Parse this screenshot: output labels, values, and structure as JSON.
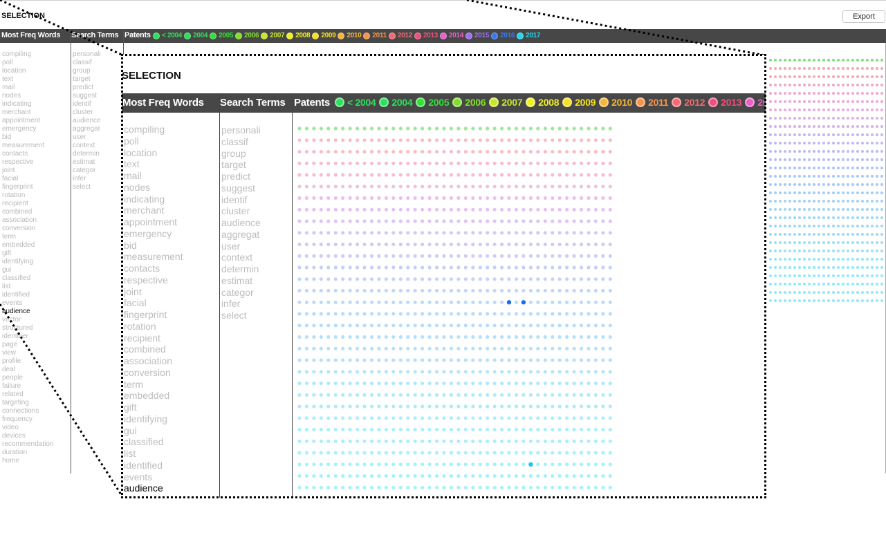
{
  "app": {
    "title": "SELECTION",
    "export_label": "Export"
  },
  "headers": {
    "most_freq_words": "Most Freq Words",
    "search_terms": "Search Terms",
    "patents": "Patents"
  },
  "legend": [
    {
      "label": "< 2004",
      "color": "#2ee05c"
    },
    {
      "label": "2004",
      "color": "#2fe05a"
    },
    {
      "label": "2005",
      "color": "#33e03a"
    },
    {
      "label": "2006",
      "color": "#7fe02a"
    },
    {
      "label": "2007",
      "color": "#c7e82a"
    },
    {
      "label": "2008",
      "color": "#f0f02a"
    },
    {
      "label": "2009",
      "color": "#f6e020"
    },
    {
      "label": "2010",
      "color": "#f4b63a"
    },
    {
      "label": "2011",
      "color": "#f4944e"
    },
    {
      "label": "2012",
      "color": "#f26a72"
    },
    {
      "label": "2013",
      "color": "#f0507e"
    },
    {
      "label": "2014",
      "color": "#e860c8"
    },
    {
      "label": "2015",
      "color": "#a070f0"
    },
    {
      "label": "2016",
      "color": "#3a78f0"
    },
    {
      "label": "2017",
      "color": "#20d8f0"
    }
  ],
  "most_freq_words": [
    "compiling",
    "poll",
    "location",
    "text",
    "mail",
    "nodes",
    "indicating",
    "merchant",
    "appointment",
    "emergency",
    "bid",
    "measurement",
    "contacts",
    "respective",
    "joint",
    "facial",
    "fingerprint",
    "rotation",
    "recipient",
    "combined",
    "association",
    "conversion",
    "term",
    "embedded",
    "gift",
    "identifying",
    "gui",
    "classified",
    "list",
    "identified",
    "events",
    "audience",
    "vector",
    "structured",
    "identifier",
    "page",
    "view",
    "profile",
    "deal",
    "people",
    "failure",
    "related",
    "targeting",
    "connections",
    "frequency",
    "video",
    "devices",
    "recommendation",
    "duration",
    "home"
  ],
  "selected_word": "audience",
  "search_terms": [
    "personali",
    "classif",
    "group",
    "target",
    "predict",
    "suggest",
    "identif",
    "cluster",
    "audience",
    "aggregat",
    "user",
    "context",
    "determin",
    "estimat",
    "categor",
    "infer",
    "select"
  ],
  "matrix": {
    "row_colors": [
      "#7ee07a",
      "#f6a8b4",
      "#f6a8b4",
      "#f4a6c0",
      "#f2a6cc",
      "#eea8d8",
      "#e6aae4",
      "#dcaeec",
      "#d2b0f0",
      "#c8b4f2",
      "#c0b8f4",
      "#b8bcf4",
      "#b2c0f6",
      "#aec4f6",
      "#a8c8f8",
      "#a4ccf8",
      "#a2cef8",
      "#a0d0f8",
      "#9ed4f8",
      "#9cd6f8",
      "#9ad8f8",
      "#98dcf8",
      "#96e0f8",
      "#94e2f8",
      "#92e4f8",
      "#90e8f8",
      "#8eeaf8",
      "#8ceaf8",
      "#8aecf8",
      "#88ecf8",
      "#86eef8",
      "#86eef8"
    ],
    "highlights": [
      {
        "row": 15,
        "col": 29,
        "color": "#1c6cf0"
      },
      {
        "row": 15,
        "col": 31,
        "color": "#1c6cf0"
      },
      {
        "row": 29,
        "col": 32,
        "color": "#18c8f0"
      }
    ]
  }
}
